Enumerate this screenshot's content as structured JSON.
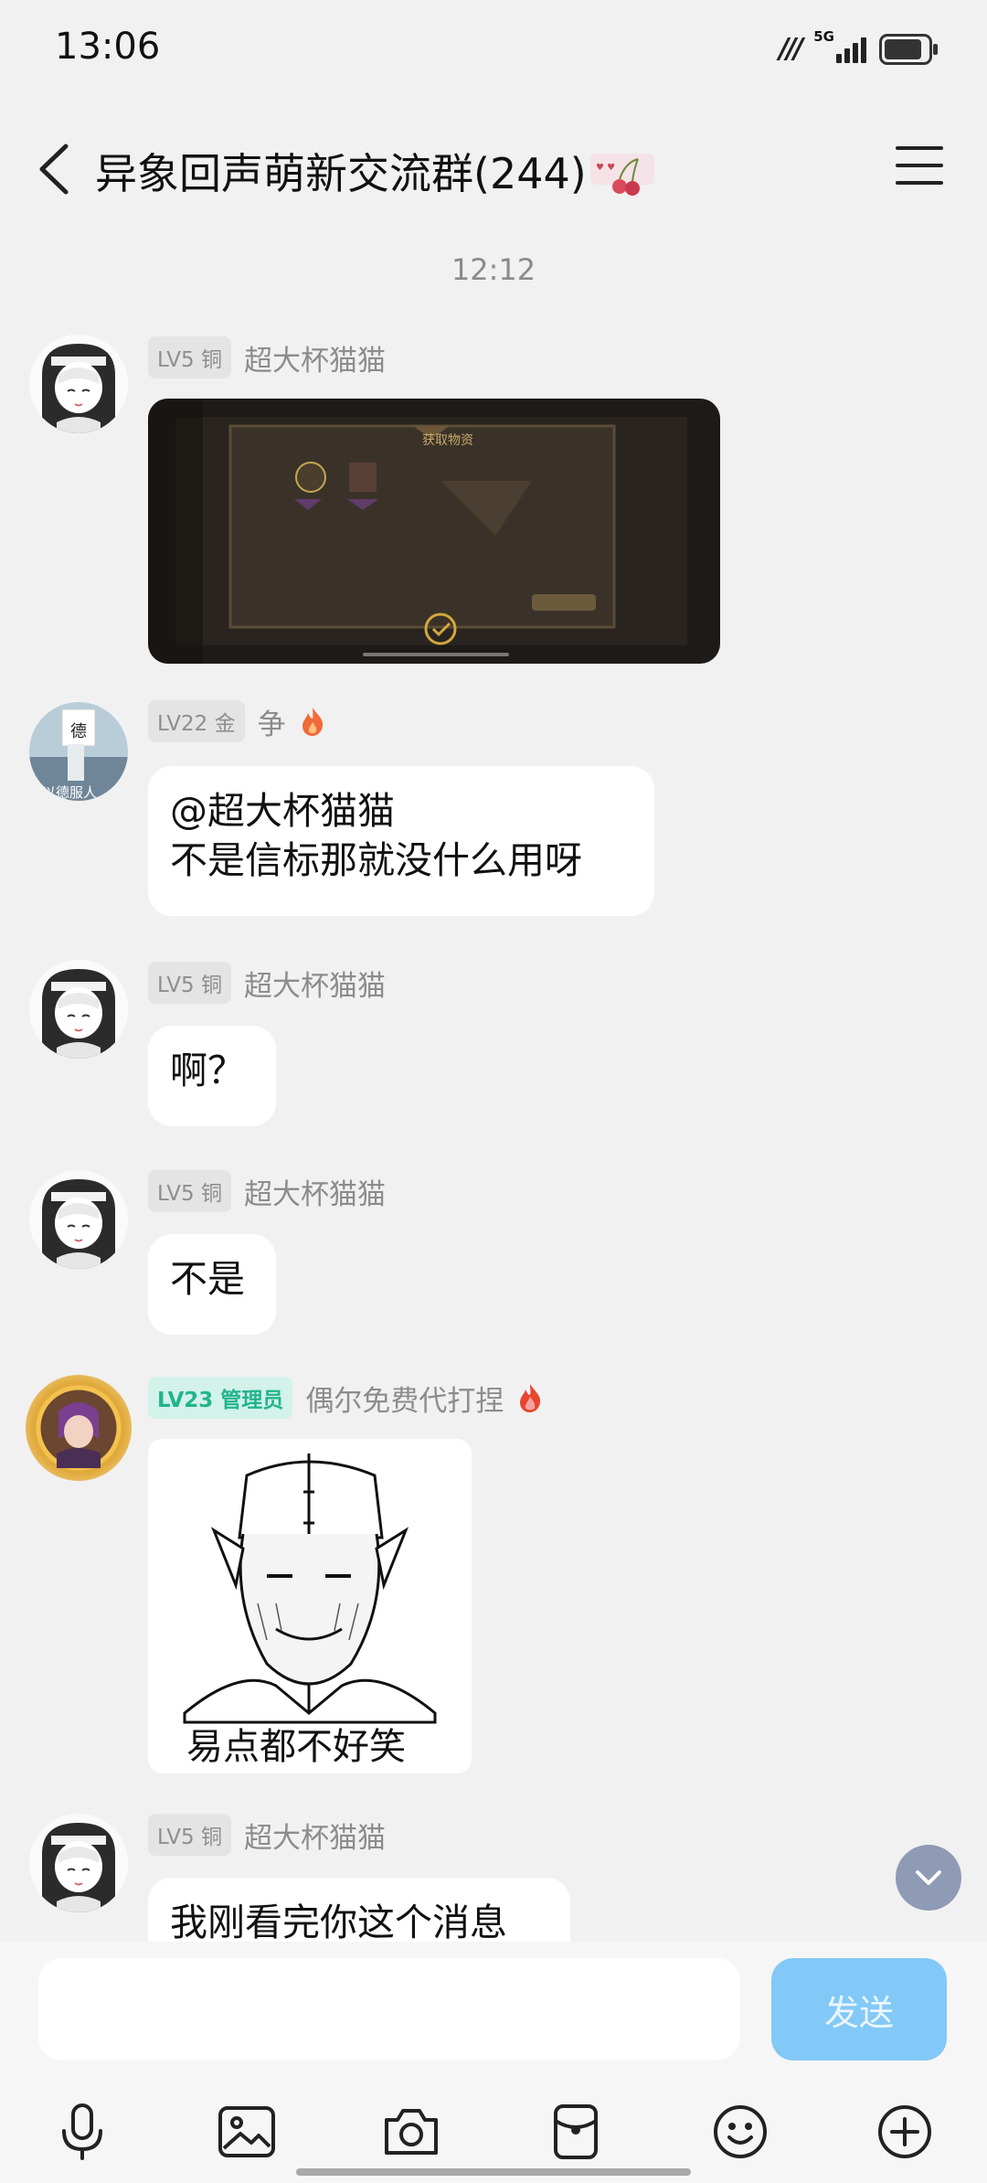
{
  "status_bar": {
    "time": "13:06",
    "network": "5G",
    "battery_level": 0.8
  },
  "header": {
    "title": "异象回声萌新交流群(244)"
  },
  "chat": {
    "time_separator": "12:12",
    "messages": [
      {
        "level": "LV5 铜",
        "nick": "超大杯猫猫",
        "type": "image",
        "image_text": "获取物资"
      },
      {
        "level": "LV22 金",
        "nick": "争",
        "type": "text",
        "lines": [
          "@超大杯猫猫",
          "不是信标那就没什么用呀"
        ],
        "avatar_caption": "以德服人",
        "avatar_sign": "德"
      },
      {
        "level": "LV5 铜",
        "nick": "超大杯猫猫",
        "type": "text",
        "lines": [
          "啊？"
        ]
      },
      {
        "level": "LV5 铜",
        "nick": "超大杯猫猫",
        "type": "text",
        "lines": [
          "不是"
        ]
      },
      {
        "level": "LV23 管理员",
        "nick": "偶尔免费代打捏",
        "type": "sticker",
        "caption": "易点都不好笑"
      },
      {
        "level": "LV5 铜",
        "nick": "超大杯猫猫",
        "type": "text",
        "lines": [
          "我刚看完你这个消息"
        ]
      }
    ]
  },
  "input": {
    "value": "",
    "placeholder": "",
    "send_label": "发送"
  },
  "toolbar": {
    "icons": [
      "microphone-icon",
      "image-icon",
      "camera-icon",
      "red-packet-icon",
      "emoji-icon",
      "plus-icon"
    ]
  },
  "colors": {
    "send_button": "#83c9f7",
    "admin_badge": "#22b48c",
    "background": "#f1f1f1"
  }
}
